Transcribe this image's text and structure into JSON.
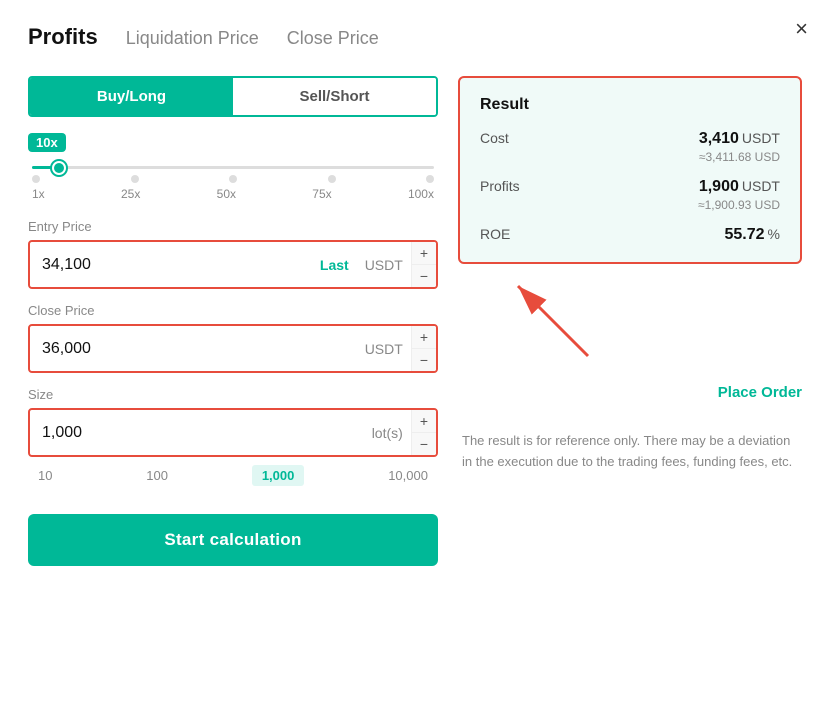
{
  "modal": {
    "close_label": "×"
  },
  "tabs": [
    {
      "id": "profits",
      "label": "Profits",
      "active": true
    },
    {
      "id": "liquidation",
      "label": "Liquidation Price",
      "active": false
    },
    {
      "id": "close",
      "label": "Close Price",
      "active": false
    }
  ],
  "trade_toggle": {
    "buy_long": "Buy/Long",
    "sell_short": "Sell/Short"
  },
  "leverage": {
    "badge": "10x",
    "marks": [
      "1x",
      "25x",
      "50x",
      "75x",
      "100x"
    ]
  },
  "fields": {
    "entry_price": {
      "label": "Entry Price",
      "value": "34,100",
      "suffix": "Last",
      "unit": "USDT"
    },
    "close_price": {
      "label": "Close Price",
      "value": "36,000",
      "unit": "USDT"
    },
    "size": {
      "label": "Size",
      "value": "1,000",
      "unit": "lot(s)",
      "options": [
        "10",
        "100",
        "1,000",
        "10,000"
      ]
    }
  },
  "calc_button": "Start calculation",
  "result": {
    "title": "Result",
    "rows": [
      {
        "label": "Cost",
        "value": "3,410",
        "unit": "USDT",
        "sub": "≈3,411.68 USD"
      },
      {
        "label": "Profits",
        "value": "1,900",
        "unit": "USDT",
        "sub": "≈1,900.93 USD"
      },
      {
        "label": "ROE",
        "value": "55.72",
        "unit": "%",
        "sub": ""
      }
    ],
    "place_order": "Place Order"
  },
  "disclaimer": "The result is for reference only. There may be a deviation in the execution due to the trading fees, funding fees, etc."
}
